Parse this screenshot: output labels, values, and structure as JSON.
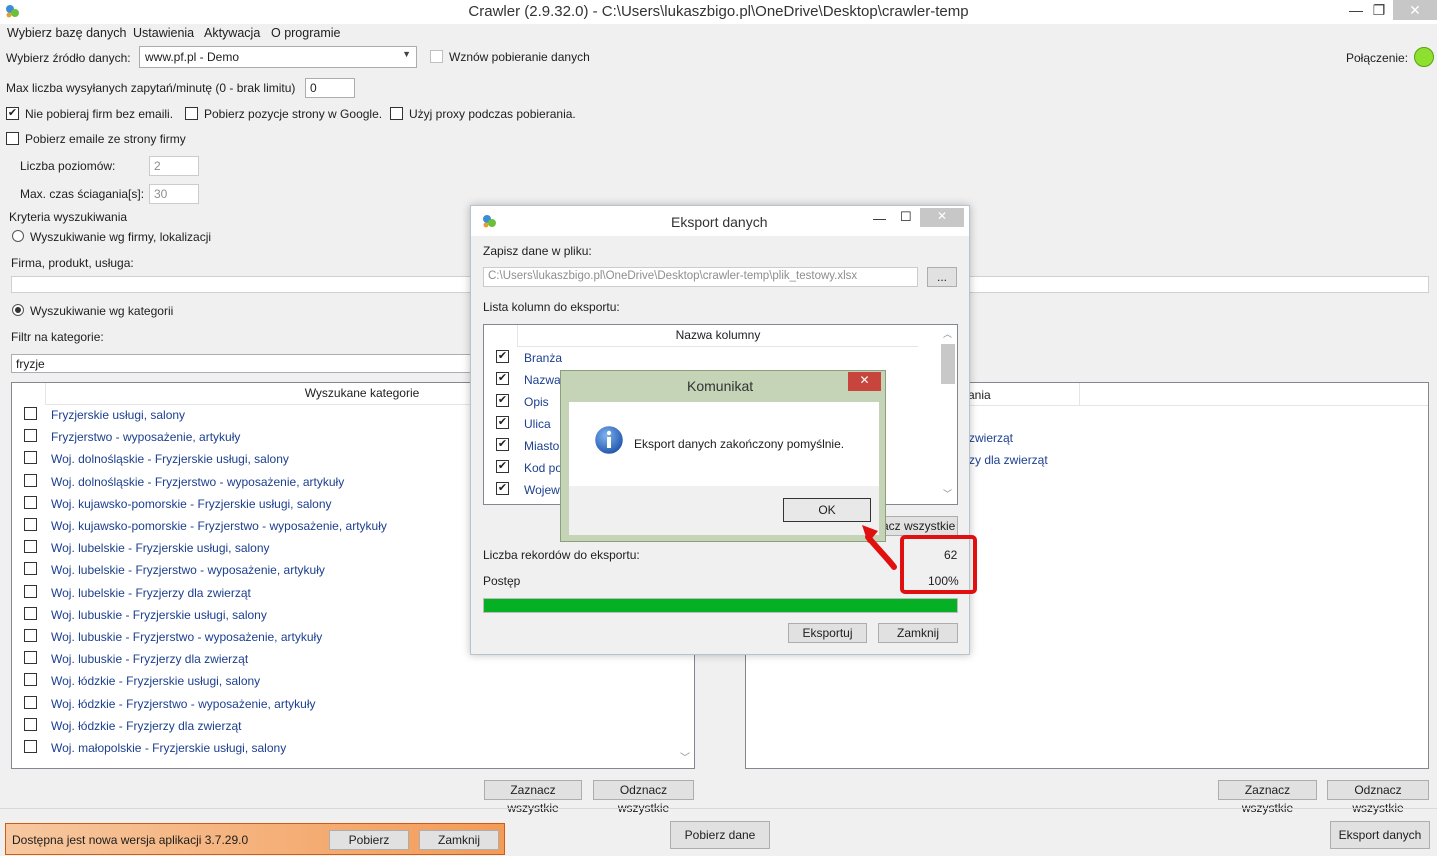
{
  "window": {
    "title": "Crawler (2.9.32.0) - C:\\Users\\lukaszbigo.pl\\OneDrive\\Desktop\\crawler-temp",
    "controls": {
      "minimize": "—",
      "maximize": "❐",
      "close": "✕"
    }
  },
  "menu": [
    "Wybierz bazę danych",
    "Ustawienia",
    "Aktywacja",
    "O programie"
  ],
  "source": {
    "label": "Wybierz źródło danych:",
    "value": "www.pf.pl - Demo",
    "resume_label": "Wznów pobieranie danych",
    "connection_label": "Połączenie:",
    "connection_color": "#8ee030"
  },
  "limits": {
    "max_requests_label": "Max liczba wysyłanych zapytań/minutę (0 - brak limitu)",
    "max_requests_value": "0"
  },
  "options": {
    "no_email": {
      "label": "Nie pobieraj firm bez emaili.",
      "checked": true
    },
    "google_pos": {
      "label": "Pobierz pozycje strony w Google.",
      "checked": false
    },
    "proxy": {
      "label": "Użyj proxy podczas pobierania.",
      "checked": false
    },
    "emails_site": {
      "label": "Pobierz emaile ze strony firmy",
      "checked": false
    },
    "levels_label": "Liczba poziomów:",
    "levels_value": "2",
    "max_time_label": "Max. czas ściagania[s]:",
    "max_time_value": "30"
  },
  "criteria": {
    "group_label": "Kryteria wyszukiwania",
    "by_company_label": "Wyszukiwanie wg firmy, lokalizacji",
    "company_field_label": "Firma, produkt, usługa:",
    "by_category_label": "Wyszukiwanie wg kategorii",
    "filter_label": "Filtr na kategorie:",
    "filter_value": "fryzje"
  },
  "left_list": {
    "header": "Wyszukane kategorie",
    "items": [
      "Fryzjerskie usługi, salony",
      "Fryzjerstwo - wyposażenie, artykuły",
      "Woj. dolnośląskie - Fryzjerskie usługi, salony",
      "Woj. dolnośląskie - Fryzjerstwo - wyposażenie, artykuły",
      "Woj. kujawsko-pomorskie - Fryzjerskie usługi, salony",
      "Woj. kujawsko-pomorskie - Fryzjerstwo - wyposażenie, artykuły",
      "Woj. lubelskie - Fryzjerskie usługi, salony",
      "Woj. lubelskie - Fryzjerstwo - wyposażenie, artykuły",
      "Woj. lubelskie - Fryzjerzy dla zwierząt",
      "Woj. lubuskie - Fryzjerskie usługi, salony",
      "Woj. lubuskie - Fryzjerstwo - wyposażenie, artykuły",
      "Woj. lubuskie - Fryzjerzy dla zwierząt",
      "Woj. łódzkie - Fryzjerskie usługi, salony",
      "Woj. łódzkie - Fryzjerstwo - wyposażenie, artykuły",
      "Woj. łódzkie - Fryzjerzy dla zwierząt",
      "Woj. małopolskie - Fryzjerskie usługi, salony"
    ],
    "select_all": "Zaznacz wszystkie",
    "deselect_all": "Odznacz wszystkie"
  },
  "right_list": {
    "header_fragment": "ania",
    "items": [
      "zwierząt",
      "zy dla zwierząt"
    ],
    "select_all": "Zaznacz wszystkie",
    "deselect_all": "Odznacz wszystkie"
  },
  "bottom": {
    "update_text": "Dostępna jest nowa wersja aplikacji  3.7.29.0",
    "update_download": "Pobierz",
    "update_close": "Zamknij",
    "fetch_button": "Pobierz dane",
    "export_button": "Eksport danych"
  },
  "export_dialog": {
    "title": "Eksport danych",
    "save_label": "Zapisz dane w pliku:",
    "file_path": "C:\\Users\\lukaszbigo.pl\\OneDrive\\Desktop\\crawler-temp\\plik_testowy.xlsx",
    "browse": "...",
    "columns_label": "Lista kolumn do eksportu:",
    "column_header": "Nazwa kolumny",
    "columns": [
      "Branża",
      "Nazwa",
      "Opis",
      "Ulica",
      "Miasto",
      "Kod po",
      "Wojew"
    ],
    "deselect_fragment": "acz wszystkie",
    "records_label": "Liczba rekordów do eksportu:",
    "records_value": "62",
    "progress_label": "Postęp",
    "progress_text": "100%",
    "progress_fraction": 1.0,
    "progress_color": "#06b025",
    "export_btn": "Eksportuj",
    "close_btn": "Zamknij"
  },
  "message_box": {
    "title": "Komunikat",
    "message": "Eksport danych zakończony pomyślnie.",
    "ok": "OK",
    "close": "✕"
  },
  "annotation": {
    "color": "#e01010"
  }
}
